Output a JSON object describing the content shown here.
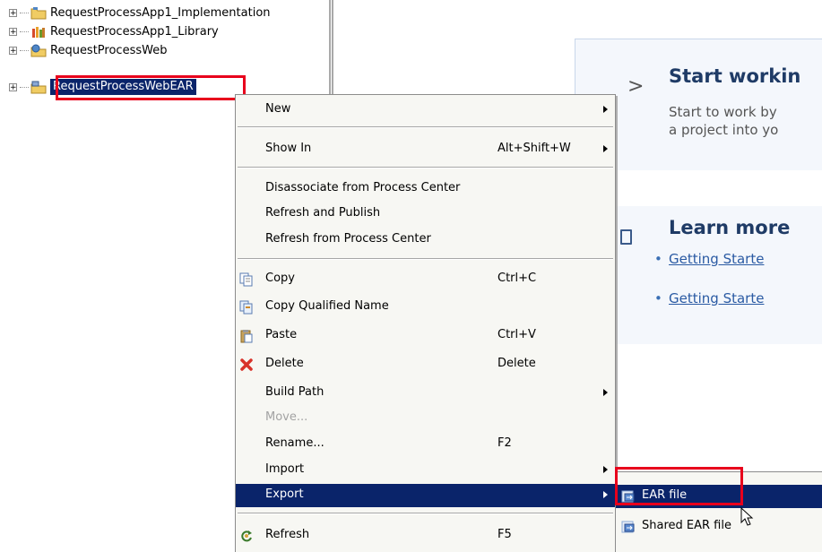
{
  "tree": {
    "items": [
      {
        "label": "RequestProcessApp1_Implementation",
        "icon": "project-folder-icon"
      },
      {
        "label": "RequestProcessApp1_Library",
        "icon": "library-icon"
      },
      {
        "label": "RequestProcessWeb",
        "icon": "web-project-icon"
      },
      {
        "label": "RequestProcessWebEAR",
        "icon": "ear-project-icon",
        "selected": true
      }
    ],
    "expander": "+"
  },
  "welcome": {
    "start_chevron": ">",
    "start_title": "Start workin",
    "start_text_1": "Start to work by",
    "start_text_2": "a project into yo",
    "learn_title": "Learn more",
    "links": [
      "Getting Starte",
      "Getting Starte"
    ],
    "bullet": "•"
  },
  "menu": {
    "items": [
      {
        "label": "New",
        "submenu": true
      },
      {
        "label": "Show In",
        "shortcut": "Alt+Shift+W",
        "submenu": true
      },
      {
        "label": "Disassociate from Process Center"
      },
      {
        "label": "Refresh and Publish"
      },
      {
        "label": "Refresh from Process Center"
      },
      {
        "label": "Copy",
        "shortcut": "Ctrl+C",
        "icon": "copy-icon"
      },
      {
        "label": "Copy Qualified Name",
        "icon": "copy-qualified-name-icon"
      },
      {
        "label": "Paste",
        "shortcut": "Ctrl+V",
        "icon": "paste-icon"
      },
      {
        "label": "Delete",
        "shortcut": "Delete",
        "icon": "delete-icon"
      },
      {
        "label": "Build Path",
        "submenu": true
      },
      {
        "label": "Move...",
        "disabled": true
      },
      {
        "label": "Rename...",
        "shortcut": "F2"
      },
      {
        "label": "Import",
        "submenu": true
      },
      {
        "label": "Export",
        "submenu": true,
        "active": true
      },
      {
        "label": "Refresh",
        "shortcut": "F5",
        "icon": "refresh-icon"
      }
    ]
  },
  "submenu": {
    "items": [
      {
        "label": "EAR file",
        "icon": "ear-file-icon",
        "active": true
      },
      {
        "label": "Shared EAR file",
        "icon": "shared-ear-file-icon"
      }
    ]
  },
  "colors": {
    "selection": "#0a246a",
    "highlight_box": "#e8001c",
    "menu_bg": "#f7f7f3",
    "heading": "#1f3b66",
    "link": "#2a5aa3"
  }
}
